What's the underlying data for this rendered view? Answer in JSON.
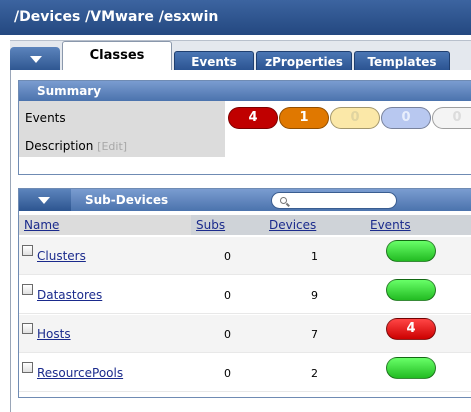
{
  "header": {
    "path": "/Devices /VMware /esxwin"
  },
  "tabs": [
    {
      "label": "Classes",
      "active": true
    },
    {
      "label": "Events",
      "active": false
    },
    {
      "label": "zProperties",
      "active": false
    },
    {
      "label": "Templates",
      "active": false
    }
  ],
  "summary": {
    "title": "Summary",
    "events_label": "Events",
    "description_label": "Description",
    "edit_label": "[Edit]",
    "event_counts": [
      {
        "value": "4",
        "color": "#c00000",
        "text_color": "#ffffff"
      },
      {
        "value": "1",
        "color": "#e07800",
        "text_color": "#ffffff"
      },
      {
        "value": "0",
        "color": "#fbe8a8",
        "text_color": "#e0d4a0"
      },
      {
        "value": "0",
        "color": "#b8c8f0",
        "text_color": "#e8eefc"
      },
      {
        "value": "0",
        "color": "#f4f4f4",
        "text_color": "#dcdcdc"
      }
    ]
  },
  "subdevices": {
    "title": "Sub-Devices",
    "search": {
      "placeholder": "",
      "value": ""
    },
    "columns": {
      "name": "Name",
      "subs": "Subs",
      "devices": "Devices",
      "events": "Events"
    },
    "rows": [
      {
        "name": "Clusters",
        "subs": "0",
        "devices": "1",
        "events": "",
        "event_color": "#22bb22"
      },
      {
        "name": "Datastores",
        "subs": "0",
        "devices": "9",
        "events": "",
        "event_color": "#22bb22"
      },
      {
        "name": "Hosts",
        "subs": "0",
        "devices": "7",
        "events": "4",
        "event_color": "#cc0000"
      },
      {
        "name": "ResourcePools",
        "subs": "0",
        "devices": "2",
        "events": "",
        "event_color": "#22bb22"
      }
    ]
  }
}
